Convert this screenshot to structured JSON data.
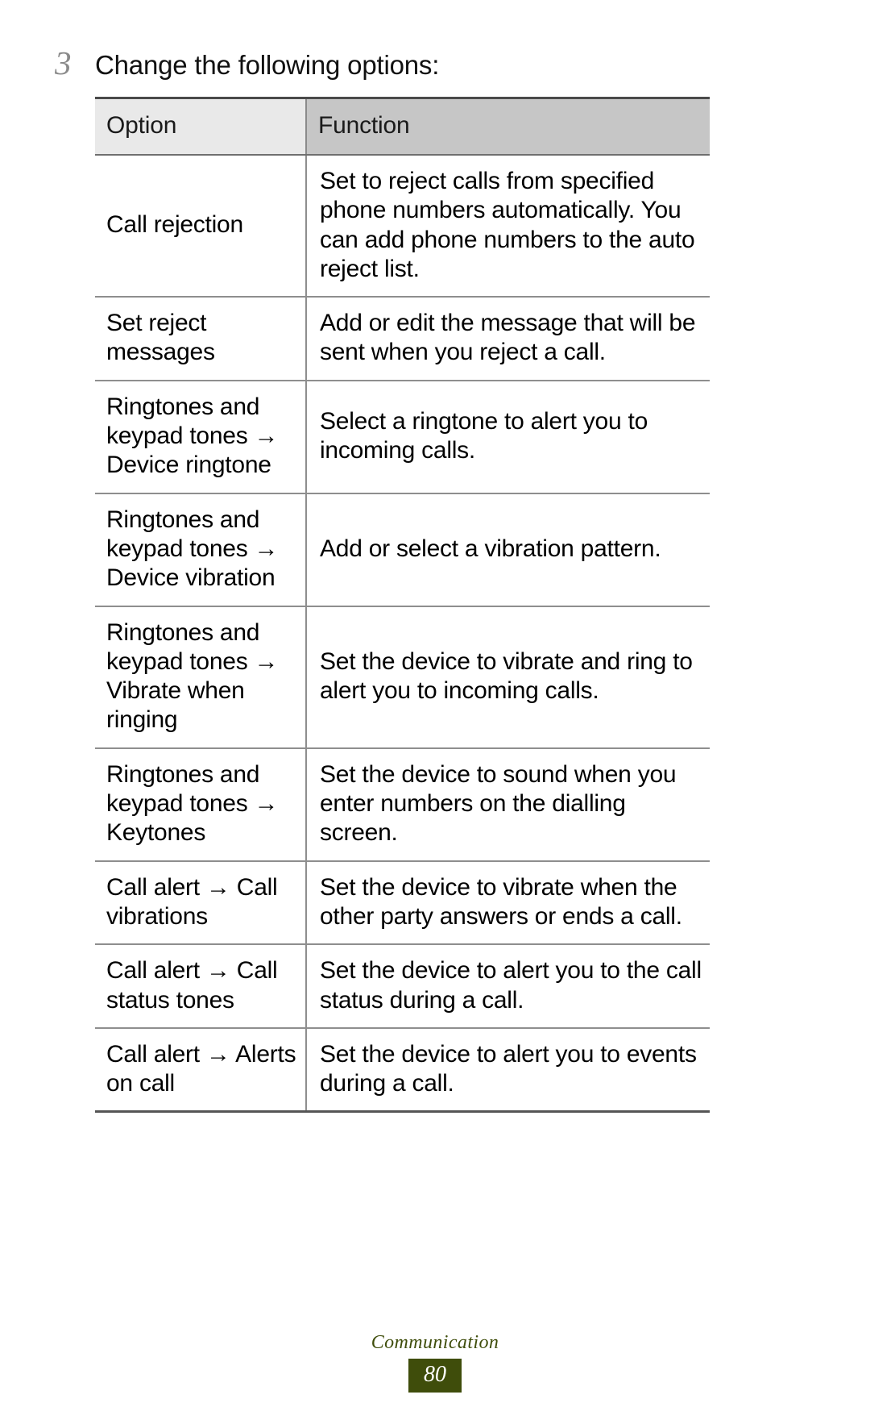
{
  "step": {
    "number": "3",
    "text": "Change the following options:"
  },
  "table": {
    "headers": {
      "option": "Option",
      "function": "Function"
    },
    "rows": [
      {
        "option": "Call rejection",
        "function": "Set to reject calls from specified phone numbers automatically. You can add phone numbers to the auto reject list."
      },
      {
        "option": "Set reject messages",
        "function": "Add or edit the message that will be sent when you reject a call."
      },
      {
        "option": "Ringtones and keypad tones → Device ringtone",
        "function": "Select a ringtone to alert you to incoming calls."
      },
      {
        "option": "Ringtones and keypad tones → Device vibration",
        "function": "Add or select a vibration pattern."
      },
      {
        "option": "Ringtones and keypad tones → Vibrate when ringing",
        "function": "Set the device to vibrate and ring to alert you to incoming calls."
      },
      {
        "option": "Ringtones and keypad tones → Keytones",
        "function": "Set the device to sound when you enter numbers on the dialling screen."
      },
      {
        "option": "Call alert → Call vibrations",
        "function": "Set the device to vibrate when the other party answers or ends a call."
      },
      {
        "option": "Call alert → Call status tones",
        "function": "Set the device to alert you to the call status during a call."
      },
      {
        "option": "Call alert → Alerts on call",
        "function": "Set the device to alert you to events during a call."
      }
    ]
  },
  "footer": {
    "section": "Communication",
    "page_number": "80",
    "accent_color": "#3f4d0b"
  }
}
